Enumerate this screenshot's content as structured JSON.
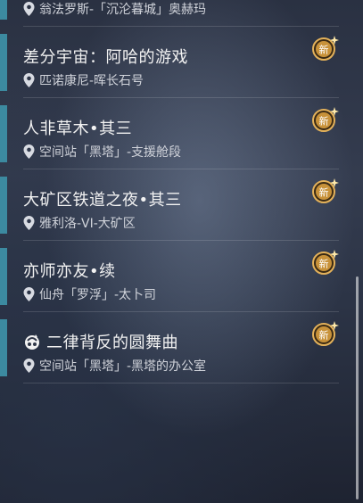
{
  "quests": [
    {
      "title": "",
      "location": "翁法罗斯-「沉沦暮城」奥赫玛",
      "is_new": false
    },
    {
      "title": "差分宇宙：阿哈的游戏",
      "location": "匹诺康尼-晖长石号",
      "is_new": true,
      "badge": "新"
    },
    {
      "title": "人非草木•其三",
      "location": "空间站「黑塔」-支援舱段",
      "is_new": true,
      "badge": "新"
    },
    {
      "title": "大矿区铁道之夜•其三",
      "location": "雅利洛-VI-大矿区",
      "is_new": true,
      "badge": "新"
    },
    {
      "title": "亦师亦友•续",
      "location": "仙舟「罗浮」-太卜司",
      "is_new": true,
      "badge": "新"
    },
    {
      "title": "二律背反的圆舞曲",
      "location": "空间站「黑塔」-黑塔的办公室",
      "is_new": true,
      "badge": "新",
      "has_icon": true
    }
  ],
  "colors": {
    "accent": "#3c8aa0",
    "badge": "#c8923a"
  }
}
